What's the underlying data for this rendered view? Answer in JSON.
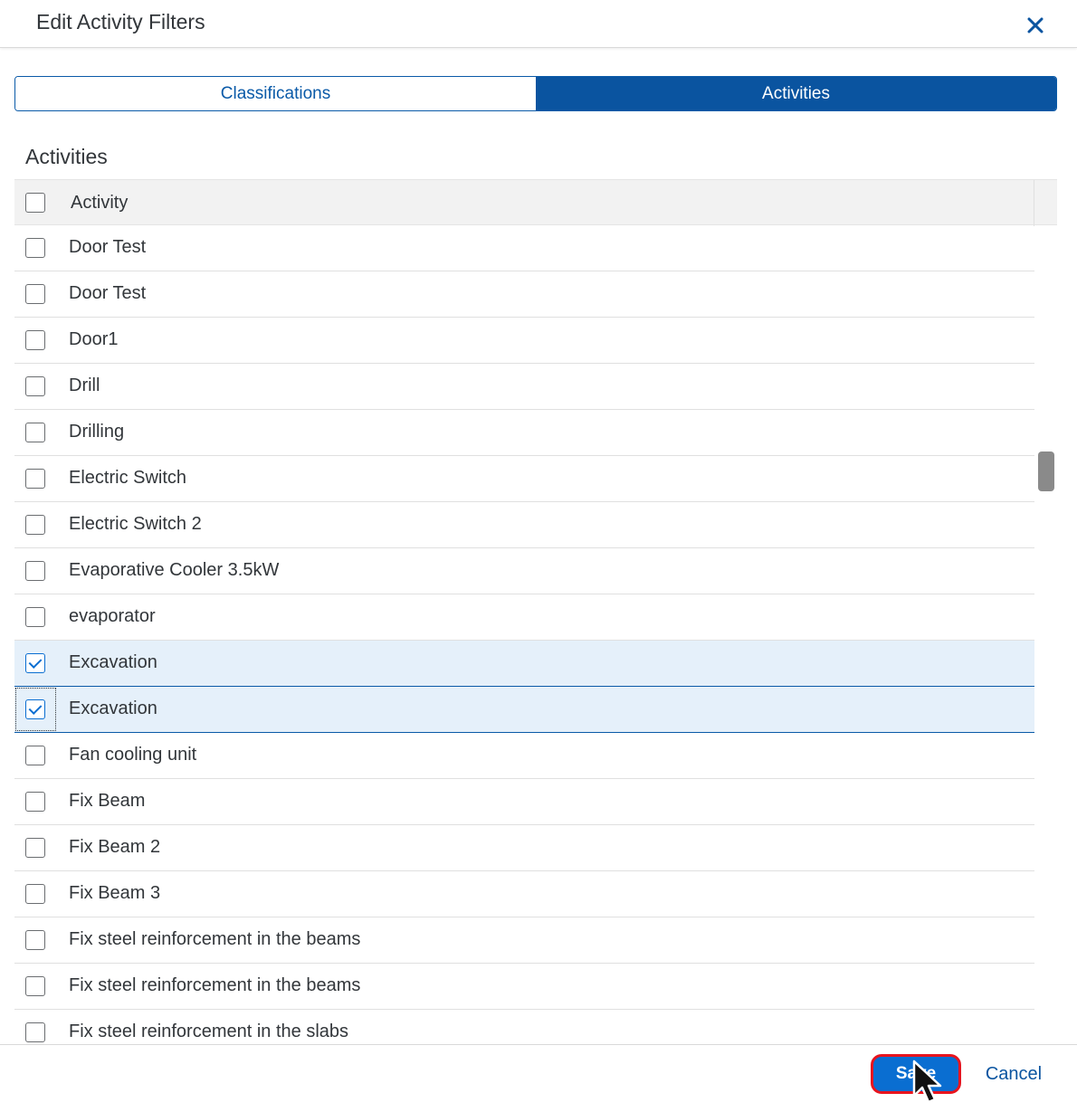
{
  "dialog": {
    "title": "Edit Activity Filters",
    "close_icon": "close-icon"
  },
  "tabs": [
    {
      "label": "Classifications",
      "active": false
    },
    {
      "label": "Activities",
      "active": true
    }
  ],
  "section_title": "Activities",
  "table": {
    "header": {
      "column": "Activity",
      "checked": false
    },
    "rows": [
      {
        "label": "Door Test",
        "checked": false
      },
      {
        "label": "Door Test",
        "checked": false
      },
      {
        "label": "Door1",
        "checked": false
      },
      {
        "label": "Drill",
        "checked": false
      },
      {
        "label": "Drilling",
        "checked": false
      },
      {
        "label": "Electric Switch",
        "checked": false
      },
      {
        "label": "Electric Switch 2",
        "checked": false
      },
      {
        "label": "Evaporative Cooler 3.5kW",
        "checked": false
      },
      {
        "label": "evaporator",
        "checked": false
      },
      {
        "label": "Excavation",
        "checked": true
      },
      {
        "label": "Excavation",
        "checked": true,
        "focused": true
      },
      {
        "label": "Fan cooling unit",
        "checked": false
      },
      {
        "label": "Fix Beam",
        "checked": false
      },
      {
        "label": "Fix Beam 2",
        "checked": false
      },
      {
        "label": "Fix Beam 3",
        "checked": false
      },
      {
        "label": "Fix steel reinforcement in the beams",
        "checked": false
      },
      {
        "label": "Fix steel reinforcement in the beams",
        "checked": false
      },
      {
        "label": "Fix steel reinforcement in the slabs",
        "checked": false
      }
    ]
  },
  "footer": {
    "save_label": "Save",
    "cancel_label": "Cancel"
  },
  "colors": {
    "accent": "#0a6ed1",
    "tab_active": "#0a54a0",
    "selected_row": "#e5f0fa",
    "highlight_ring": "#e8141e"
  }
}
